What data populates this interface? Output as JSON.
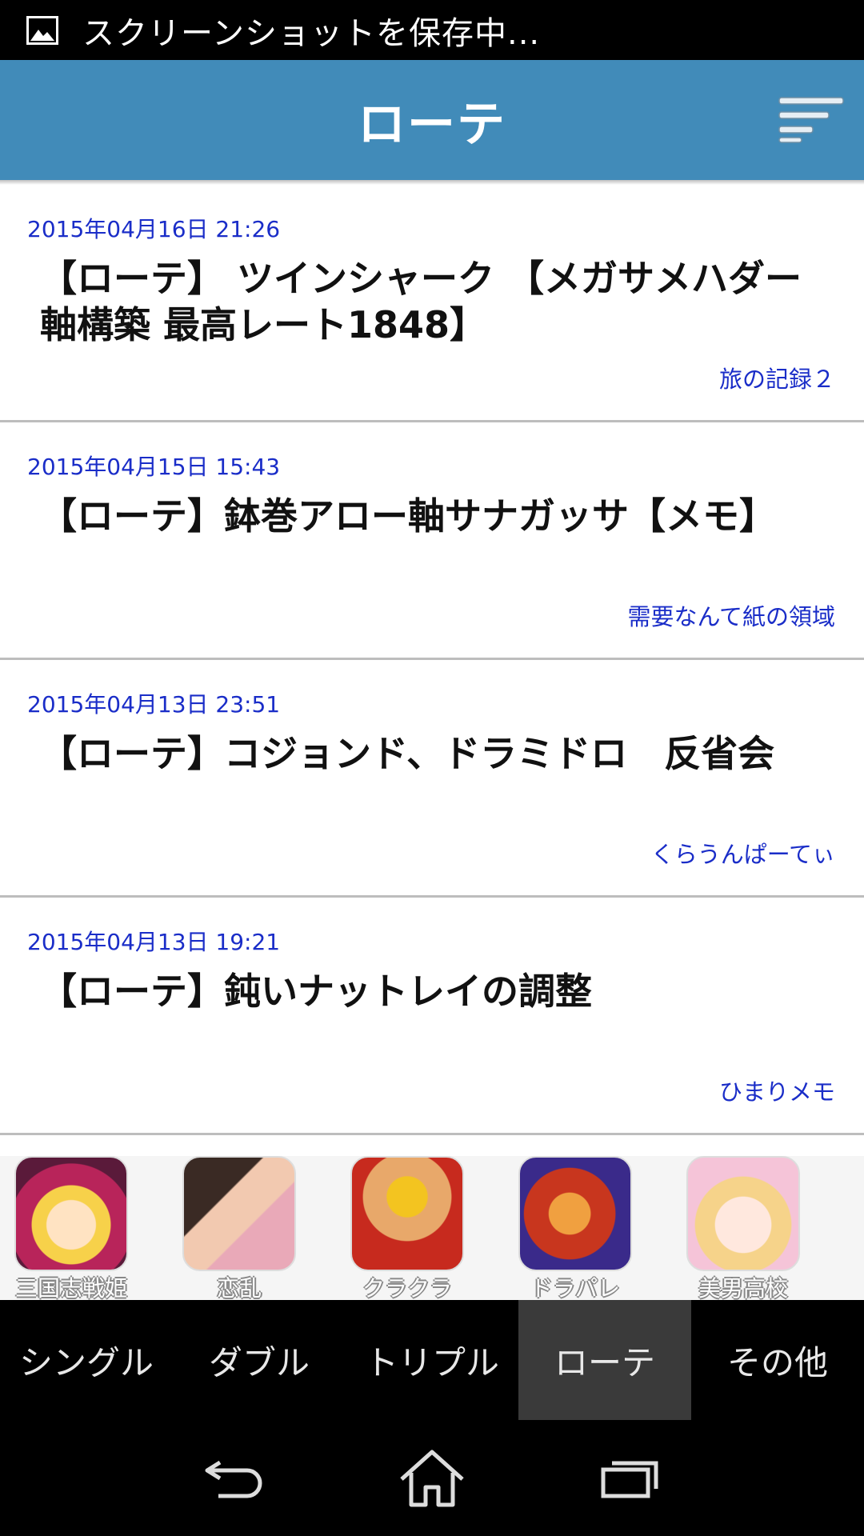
{
  "status_bar": {
    "text": "スクリーンショットを保存中..."
  },
  "header": {
    "title": "ローテ",
    "menu_icon": "menu-lines-icon"
  },
  "articles": [
    {
      "date": "2015年04月16日 21:26",
      "title": "【ローテ】 ツインシャーク 【メガサメハダー軸構築 最高レート1848】",
      "source": "旅の記録２"
    },
    {
      "date": "2015年04月15日 15:43",
      "title": "【ローテ】鉢巻アロー軸サナガッサ【メモ】",
      "source": "需要なんて紙の領域"
    },
    {
      "date": "2015年04月13日 23:51",
      "title": "【ローテ】コジョンド、ドラミドロ　反省会",
      "source": "くらうんぱーてぃ"
    },
    {
      "date": "2015年04月13日 19:21",
      "title": "【ローテ】鈍いナットレイの調整",
      "source": "ひまりメモ"
    }
  ],
  "ads": [
    {
      "label": "三国志戦姫",
      "icon": "app-icon-sangokushi"
    },
    {
      "label": "恋乱",
      "icon": "app-icon-koiran"
    },
    {
      "label": "クラクラ",
      "icon": "app-icon-clash"
    },
    {
      "label": "ドラパレ",
      "icon": "app-icon-drapare"
    },
    {
      "label": "美男高校",
      "icon": "app-icon-binan"
    }
  ],
  "tabs": [
    {
      "label": "シングル",
      "active": false
    },
    {
      "label": "ダブル",
      "active": false
    },
    {
      "label": "トリプル",
      "active": false
    },
    {
      "label": "ローテ",
      "active": true
    },
    {
      "label": "その他",
      "active": false
    }
  ],
  "nav": {
    "back_icon": "back-icon",
    "home_icon": "home-icon",
    "recents_icon": "recents-icon"
  },
  "colors": {
    "header": "#418bb9",
    "date_link": "#1a2dc8",
    "active_tab": "#3a3a3a"
  }
}
